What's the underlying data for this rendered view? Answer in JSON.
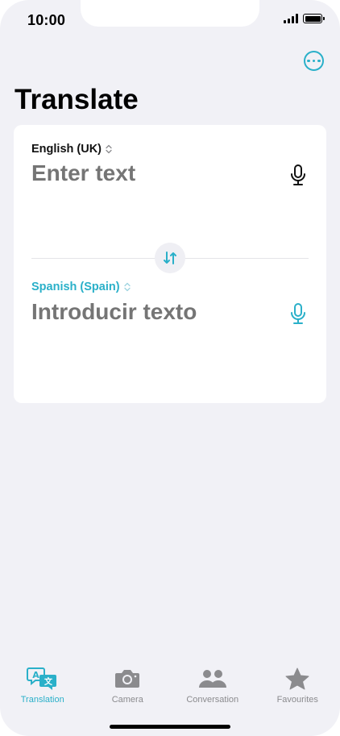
{
  "status_bar": {
    "time": "10:00"
  },
  "header": {
    "title": "Translate",
    "more_icon": "ellipsis-circle-icon"
  },
  "source": {
    "language": "English (UK)",
    "placeholder": "Enter text",
    "value": ""
  },
  "target": {
    "language": "Spanish (Spain)",
    "placeholder": "Introducir texto",
    "value": ""
  },
  "tabs": [
    {
      "label": "Translation",
      "icon": "translate-icon",
      "active": true
    },
    {
      "label": "Camera",
      "icon": "camera-icon",
      "active": false
    },
    {
      "label": "Conversation",
      "icon": "people-icon",
      "active": false
    },
    {
      "label": "Favourites",
      "icon": "star-icon",
      "active": false
    }
  ],
  "colors": {
    "accent": "#2ab0c9",
    "background": "#f1f1f6",
    "card": "#ffffff",
    "inactive": "#8b8b8e"
  }
}
